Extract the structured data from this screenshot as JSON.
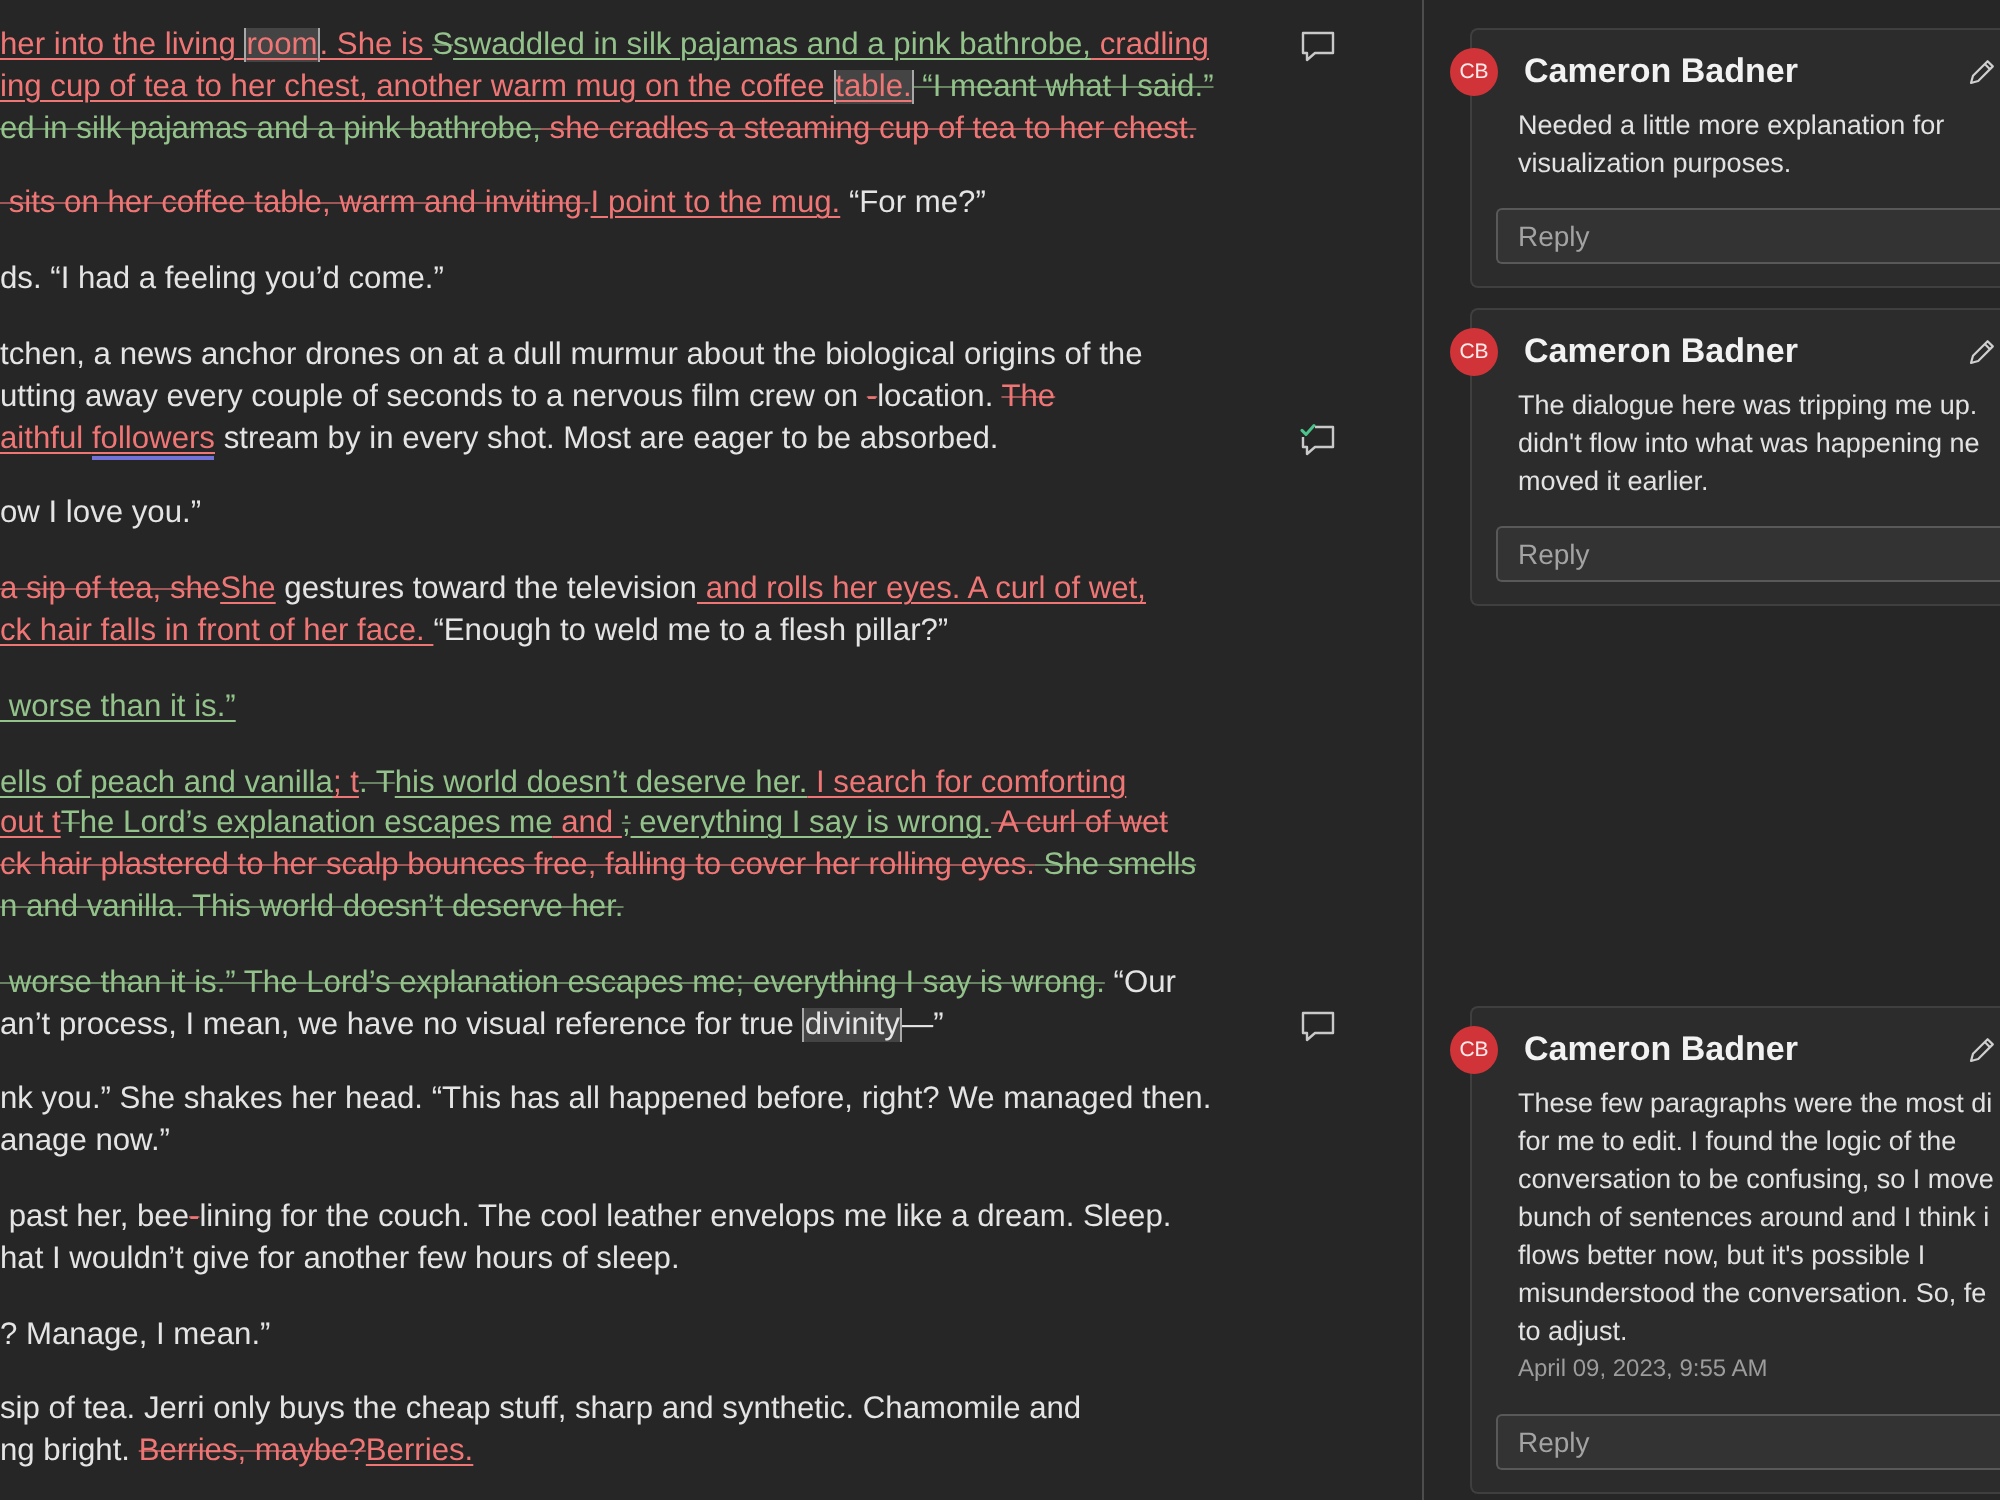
{
  "document": {
    "paragraphs": [
      {
        "lines": [
          {
            "marker": {
              "kind": "comment"
            },
            "segments": [
              {
                "text": "her into the living ",
                "kind": "insert"
              },
              {
                "text": "room",
                "kind": "insert_anchor"
              },
              {
                "text": ". She is ",
                "kind": "insert"
              },
              {
                "text": "S",
                "kind": "move_from"
              },
              {
                "text": "swaddled in silk pajamas and a pink bathrobe,",
                "kind": "move_to"
              },
              {
                "text": " cradling",
                "kind": "insert"
              }
            ]
          },
          {
            "segments": [
              {
                "text": "ing cup of tea to her chest, another warm mug on the coffee ",
                "kind": "insert"
              },
              {
                "text": "table.",
                "kind": "insert_anchor"
              },
              {
                "text": " “I meant what I said.”",
                "kind": "move_from"
              }
            ]
          },
          {
            "segments": [
              {
                "text": "ed in silk pajamas and a pink bathrobe,",
                "kind": "move_from"
              },
              {
                "text": " she cradles a steaming cup of tea to her chest.",
                "kind": "delete"
              }
            ]
          }
        ]
      },
      {
        "lines": [
          {
            "segments": [
              {
                "text": " sits on her coffee table, warm and inviting.",
                "kind": "delete"
              },
              {
                "text": "I point to the mug.",
                "kind": "insert"
              },
              {
                "text": " “For me?”",
                "kind": "plain"
              }
            ]
          }
        ]
      },
      {
        "lines": [
          {
            "segments": [
              {
                "text": "ds. “I had a feeling you’d come.”",
                "kind": "plain"
              }
            ]
          }
        ]
      },
      {
        "lines": [
          {
            "segments": [
              {
                "text": "tchen, a news anchor drones on at a dull murmur about the biological origins of the",
                "kind": "plain"
              }
            ]
          },
          {
            "segments": [
              {
                "text": "utting away every couple of seconds to a nervous film crew on ",
                "kind": "plain"
              },
              {
                "text": "-",
                "kind": "delete"
              },
              {
                "text": "location. ",
                "kind": "plain"
              },
              {
                "text": "The",
                "kind": "delete"
              }
            ]
          },
          {
            "marker": {
              "kind": "resolved"
            },
            "segments": [
              {
                "text": "aithful ",
                "kind": "insert"
              },
              {
                "text": "followers",
                "kind": "insert_flag"
              },
              {
                "text": " stream by in every shot. Most are eager to be absorbed.",
                "kind": "plain"
              }
            ]
          }
        ]
      },
      {
        "lines": [
          {
            "segments": [
              {
                "text": "ow I love you.”",
                "kind": "plain"
              }
            ]
          }
        ]
      },
      {
        "lines": [
          {
            "segments": [
              {
                "text": "a sip of tea, she",
                "kind": "delete"
              },
              {
                "text": "She",
                "kind": "insert"
              },
              {
                "text": " gestures toward the television",
                "kind": "plain"
              },
              {
                "text": " and rolls her eyes. A curl of wet,",
                "kind": "insert"
              }
            ]
          },
          {
            "segments": [
              {
                "text": "ck hair falls in front of her face. ",
                "kind": "insert"
              },
              {
                "text": "“Enough to weld me to a flesh pillar?”",
                "kind": "plain"
              }
            ]
          }
        ]
      },
      {
        "lines": [
          {
            "segments": [
              {
                "text": " worse than it is.”",
                "kind": "move_to"
              }
            ]
          }
        ]
      },
      {
        "lines": [
          {
            "segments": [
              {
                "text": "ells of peach and vanilla",
                "kind": "move_to"
              },
              {
                "text": "; t",
                "kind": "insert"
              },
              {
                "text": ". T",
                "kind": "move_from"
              },
              {
                "text": "his world doesn’t deserve her.",
                "kind": "move_to"
              },
              {
                "text": " I search for comforting",
                "kind": "insert"
              }
            ]
          },
          {
            "segments": [
              {
                "text": "out t",
                "kind": "insert"
              },
              {
                "text": "T",
                "kind": "move_from"
              },
              {
                "text": "he Lord’s explanation escapes me",
                "kind": "move_to"
              },
              {
                "text": " and ",
                "kind": "insert"
              },
              {
                "text": ";",
                "kind": "move_from"
              },
              {
                "text": " everything I say is wrong.",
                "kind": "move_to"
              },
              {
                "text": " A curl of wet",
                "kind": "delete"
              }
            ]
          },
          {
            "segments": [
              {
                "text": "ck hair plastered to her scalp bounces free, falling to cover her rolling eyes.",
                "kind": "delete"
              },
              {
                "text": " She smells",
                "kind": "move_from"
              }
            ]
          },
          {
            "segments": [
              {
                "text": "n and vanilla. This world doesn’t deserve her.",
                "kind": "move_from"
              }
            ]
          }
        ]
      },
      {
        "lines": [
          {
            "segments": [
              {
                "text": " worse than it is.” The Lord’s explanation escapes me; everything I say is wrong.",
                "kind": "move_from"
              },
              {
                "text": " “Our",
                "kind": "plain"
              }
            ]
          },
          {
            "marker": {
              "kind": "comment"
            },
            "segments": [
              {
                "text": "an’t process, I mean, we have no visual reference for true ",
                "kind": "plain"
              },
              {
                "text": "divinity",
                "kind": "plain_anchor"
              },
              {
                "text": "—”",
                "kind": "plain"
              }
            ]
          }
        ]
      },
      {
        "lines": [
          {
            "segments": [
              {
                "text": "nk you.” She shakes her head. “This has all happened before, right? We managed then.",
                "kind": "plain"
              }
            ]
          },
          {
            "segments": [
              {
                "text": "anage now.”",
                "kind": "plain"
              }
            ]
          }
        ]
      },
      {
        "lines": [
          {
            "segments": [
              {
                "text": " past her, bee",
                "kind": "plain"
              },
              {
                "text": "-",
                "kind": "delete"
              },
              {
                "text": "lining for the couch. The cool leather envelops me like a dream. Sleep.",
                "kind": "plain"
              }
            ]
          },
          {
            "segments": [
              {
                "text": "hat I wouldn’t give for another few hours of sleep.",
                "kind": "plain"
              }
            ]
          }
        ]
      },
      {
        "lines": [
          {
            "segments": [
              {
                "text": "? Manage, I mean.”",
                "kind": "plain"
              }
            ]
          }
        ]
      },
      {
        "lines": [
          {
            "segments": [
              {
                "text": "sip of tea. Jerri only buys the cheap stuff, sharp and synthetic. Chamomile and",
                "kind": "plain"
              }
            ]
          },
          {
            "segments": [
              {
                "text": "ng bright. ",
                "kind": "plain"
              },
              {
                "text": "Berries, maybe?",
                "kind": "delete"
              },
              {
                "text": "Berries.",
                "kind": "insert"
              }
            ]
          }
        ]
      }
    ]
  },
  "comments": [
    {
      "initials": "CB",
      "author": "Cameron Badner",
      "lines": [
        "Needed a little more explanation for",
        "visualization purposes."
      ],
      "reply": {
        "placeholder": "Reply"
      }
    },
    {
      "initials": "CB",
      "author": "Cameron Badner",
      "lines": [
        "The dialogue here was tripping me up.",
        "didn't flow into what was happening ne",
        "moved it earlier."
      ],
      "reply": {
        "placeholder": "Reply"
      }
    },
    {
      "initials": "CB",
      "author": "Cameron Badner",
      "lines": [
        "These few paragraphs were the most di",
        "for me to edit. I found the logic of the",
        "conversation to be confusing, so I move",
        "bunch of sentences around and I think i",
        "flows better now, but it's possible I",
        "misunderstood the conversation. So, fe",
        "to adjust."
      ],
      "date": "April 09, 2023, 9:55 AM",
      "reply": {
        "placeholder": "Reply"
      }
    }
  ]
}
